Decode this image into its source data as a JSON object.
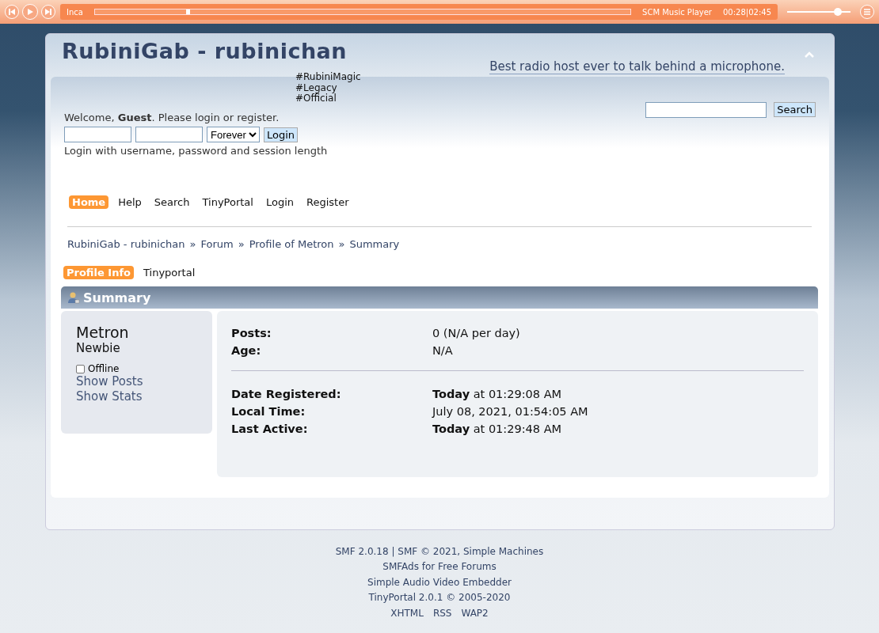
{
  "player": {
    "track": "Inca",
    "progress": {
      "level": 0.17
    },
    "name": "SCM Music Player",
    "time": "00:28|02:45",
    "volume": {
      "level": 0.8
    }
  },
  "header": {
    "title": "RubiniGab - rubinichan",
    "slogan": "Best radio host ever to talk behind a microphone.",
    "tags": [
      "#RubiniMagic",
      "#Legacy",
      "#Official"
    ]
  },
  "user": {
    "welcome": "Welcome, **Guest**. Please login or register.",
    "session_option": "Forever",
    "login_button": "Login",
    "hint": "Login with username, password and session length"
  },
  "search": {
    "button": "Search"
  },
  "menu": [
    {
      "label": "Home",
      "selected": true
    },
    {
      "label": "Help",
      "selected": false
    },
    {
      "label": "Search",
      "selected": false
    },
    {
      "label": "TinyPortal",
      "selected": false
    },
    {
      "label": "Login",
      "selected": false
    },
    {
      "label": "Register",
      "selected": false
    }
  ],
  "breadcrumb": [
    "RubiniGab - rubinichan",
    "Forum",
    "Profile of Metron",
    "Summary"
  ],
  "breadcrumb_separator": "»",
  "profile_tabs": [
    {
      "label": "Profile Info",
      "selected": true
    },
    {
      "label": "Tinyportal",
      "selected": false
    }
  ],
  "section_title": "Summary",
  "profile": {
    "name": "Metron",
    "rank": "Newbie",
    "status": "Offline",
    "online": false,
    "links": [
      "Show Posts",
      "Show Stats"
    ]
  },
  "stat_groups": [
    [
      {
        "label": "Posts:",
        "value": "0 (N/A per day)"
      },
      {
        "label": "Age:",
        "value": "N/A"
      }
    ],
    [
      {
        "label": "Date Registered:",
        "value": "**Today** at 01:29:08 AM"
      },
      {
        "label": "Local Time:",
        "value": "July 08, 2021, 01:54:05 AM"
      },
      {
        "label": "Last Active:",
        "value": "**Today** at 01:29:48 AM"
      }
    ]
  ],
  "footer": [
    [
      "SMF 2.0.18 | SMF © 2021, Simple Machines"
    ],
    [
      "SMFAds for Free Forums"
    ],
    [
      "Simple Audio Video Embedder"
    ],
    [
      "TinyPortal 2.0.1 © 2005-2020"
    ],
    [
      "XHTML",
      "RSS",
      "WAP2"
    ]
  ]
}
